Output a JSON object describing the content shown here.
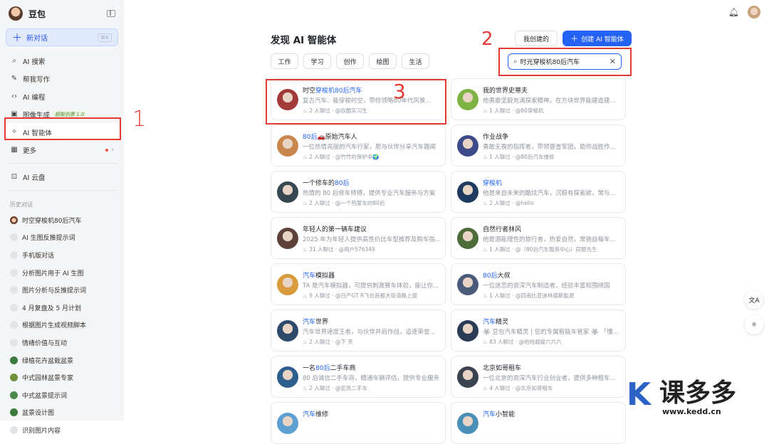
{
  "sidebar": {
    "brand": "豆包",
    "new_chat": "新对话",
    "new_chat_shortcut": "⌘K",
    "nav": [
      {
        "label": "AI 搜索",
        "icon": "search-icon"
      },
      {
        "label": "帮我写作",
        "icon": "pen-icon"
      },
      {
        "label": "AI 编程",
        "icon": "code-icon"
      },
      {
        "label": "图像生成",
        "icon": "image-icon",
        "badge": "超能创意 1.0"
      },
      {
        "label": "AI 智能体",
        "icon": "sparkle-icon"
      },
      {
        "label": "更多",
        "icon": "grid-icon"
      }
    ],
    "cloud": "AI 云盘",
    "history_title": "历史对话",
    "history": [
      "时空穿梭机80后汽车",
      "AI 生图反推提示词",
      "手机版对话",
      "分析图片用于 AI 生图",
      "图片分析与反推提示词",
      "4 月复盘及 5 月计划",
      "根据图片生成视频脚本",
      "情绪价值与互动",
      "绿植花卉盆栽盆景",
      "中式园林盆景专家",
      "中式盆景提示词",
      "盆景设计图",
      "识别图片内容"
    ]
  },
  "main": {
    "title": "发现 AI 智能体",
    "my_created": "我创建的",
    "create_button": "创建 AI 智能体",
    "categories": [
      "工作",
      "学习",
      "创作",
      "绘图",
      "生活"
    ],
    "search_value": "时光穿梭机80后汽车",
    "cards": [
      {
        "pre": "时空",
        "hl": "穿梭机80后汽车",
        "post": "",
        "desc": "复古汽车、能穿梭时空，带你领略80年代风景...",
        "meta": "♨ 2 人聊过 · @玖酷实习生",
        "col": "#a23a3a"
      },
      {
        "pre": "我的世界史蒂夫",
        "hl": "",
        "post": "",
        "desc": "他勇敢坚毅充满探索精神，在方块世界能建造建...",
        "meta": "♨ 1 人聊过 · @80穿梭机",
        "col": "#7cb342"
      },
      {
        "pre": "",
        "hl": "80后",
        "post": "🚗原始汽车人",
        "desc": "一位热情亮丽的汽车行家，愿与伙伴分享汽车趣闻",
        "meta": "♨ 2 人聊过 · @竹竹的保护伞🌍",
        "col": "#c8864b"
      },
      {
        "pre": "作业战争",
        "hl": "",
        "post": "",
        "desc": "勇敢无畏的指挥者，带领督查军团，助你战胜作...",
        "meta": "♨ 1 人聊过 · @80后汽车维修",
        "col": "#3d4a8a"
      },
      {
        "pre": "一个修车的",
        "hl": "80后",
        "post": "",
        "desc": "热情的 80 后修车师傅，提供专业汽车服务与方案",
        "meta": "♨ 2 人聊过 · @一个热爱车的80后",
        "col": "#37474f"
      },
      {
        "pre": "",
        "hl": "穿梭机",
        "post": "",
        "desc": "他是来自未来的酷炫汽车，沉稳有探索欲，常与...",
        "meta": "♨ 2 人聊过 · @hello",
        "col": "#1e3a5f"
      },
      {
        "pre": "年轻人的第一辆车建议",
        "hl": "",
        "post": "",
        "desc": "2025 年为年轻人提供高性价比车型推荐及购车指...",
        "meta": "♨ 31 人聊过 · @用户576349",
        "col": "#5d4037"
      },
      {
        "pre": "自然行者林风",
        "hl": "",
        "post": "",
        "desc": "他是酒能理性的旅行者，热爱自然，常驰自每车...",
        "meta": "♨ 1 人聊过 · @（80后汽车服务中心）同窗先生",
        "col": "#4e6b3a"
      },
      {
        "pre": "",
        "hl": "汽车",
        "post": "模拟器",
        "desc": "TA 是汽车模拟器，可提供刺激赛车体验，能让你...",
        "meta": "♨ 9 人聊过 · @日产GT R飞在首都大街道路上面",
        "col": "#d99a3c"
      },
      {
        "pre": "",
        "hl": "80后",
        "post": "大叔",
        "desc": "一位迷恋的资深汽车制造者，经验丰富和围绕国",
        "meta": "♨ 1 人聊过 · @同南比亚迪林德斯能源",
        "col": "#4a5a7a"
      },
      {
        "pre": "",
        "hl": "汽车",
        "post": "世界",
        "desc": "汽车世界速度王者，与伙伴并肩作战，追逐荣誉...",
        "meta": "♨ 2 人聊过 · @下 天",
        "col": "#2e4a6b"
      },
      {
        "pre": "",
        "hl": "汽车",
        "post": "精灵",
        "desc": "🏵 豆包汽车精灵 | 您的专属智能车管家 🏵 「懂...",
        "meta": "♨ 83 人聊过 · @哈哈超级六六六",
        "col": "#2b3a55"
      },
      {
        "pre": "一名",
        "hl": "80后",
        "post": "二手车商",
        "desc": "80 后诚信二手车商，精通车辆评估，提供专业服务",
        "meta": "♨ 2 人聊过 · @宏亮二手车",
        "col": "#2f5f8f"
      },
      {
        "pre": "北京如哥租车",
        "hl": "",
        "post": "",
        "desc": "一位北京的资深汽车行业创业者，提供多种租车...",
        "meta": "♨ 4 人聊过 · @北京如哥租车",
        "col": "#3b4250"
      },
      {
        "pre": "",
        "hl": "汽车",
        "post": "维修",
        "desc": "",
        "meta": "",
        "col": "#5ba0d0"
      },
      {
        "pre": "",
        "hl": "汽车",
        "post": "小智能",
        "desc": "",
        "meta": "",
        "col": "#4a8fb8"
      }
    ]
  },
  "annotations": [
    "1",
    "2",
    "3"
  ],
  "watermark": {
    "k": "K",
    "text": "课多多",
    "url": "www.kedd.cn"
  },
  "side_tools": [
    "文A",
    "⚛"
  ]
}
